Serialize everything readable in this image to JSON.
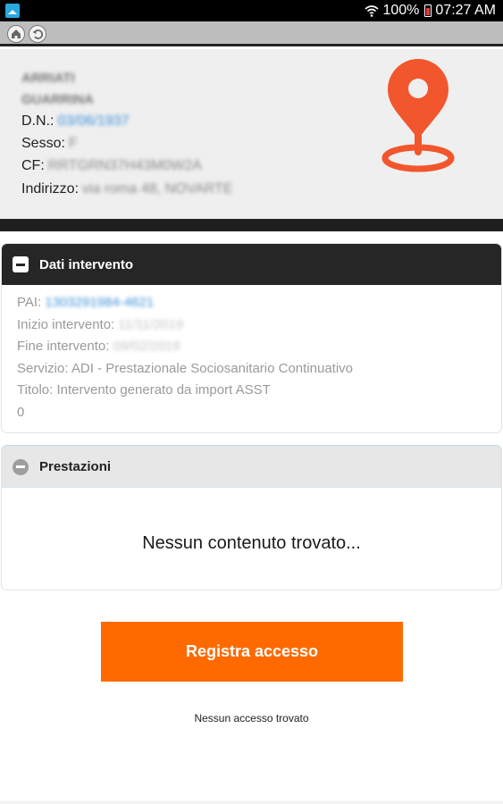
{
  "status_bar": {
    "battery": "100%",
    "time": "07:27 AM",
    "battery_color": "#e53935"
  },
  "toolbar": {
    "home_icon": "home-icon",
    "back_icon": "back-arrow-icon"
  },
  "patient": {
    "surname": "ARRIATI",
    "first_name": "GUARRINA",
    "dn_label": "D.N.:",
    "dn_value": "03/06/1937",
    "sesso_label": "Sesso:",
    "sesso_value": "F",
    "cf_label": "CF:",
    "cf_value": "RRTGRN37H43M0W2A",
    "indirizzo_label": "Indirizzo:",
    "indirizzo_value": "via roma 48, NOVARTE",
    "icon": "location-pin-icon",
    "accent_color": "#f2562d"
  },
  "dati_intervento": {
    "title": "Dati intervento",
    "pai_label": "PAI:",
    "pai_value": "1303291984-4621",
    "inizio_label": "Inizio intervento:",
    "inizio_value": "11/11/2019",
    "fine_label": "Fine intervento:",
    "fine_value": "09/02/2019",
    "servizio": "Servizio: ADI - Prestazionale Sociosanitario Continuativo",
    "titolo": "Titolo: Intervento generato da import ASST",
    "extra": "0"
  },
  "prestazioni": {
    "title": "Prestazioni",
    "empty_text": "Nessun contenuto trovato..."
  },
  "actions": {
    "registra_label": "Registra accesso",
    "registra_color": "#ff6a00",
    "no_access_text": "Nessun accesso trovato"
  }
}
